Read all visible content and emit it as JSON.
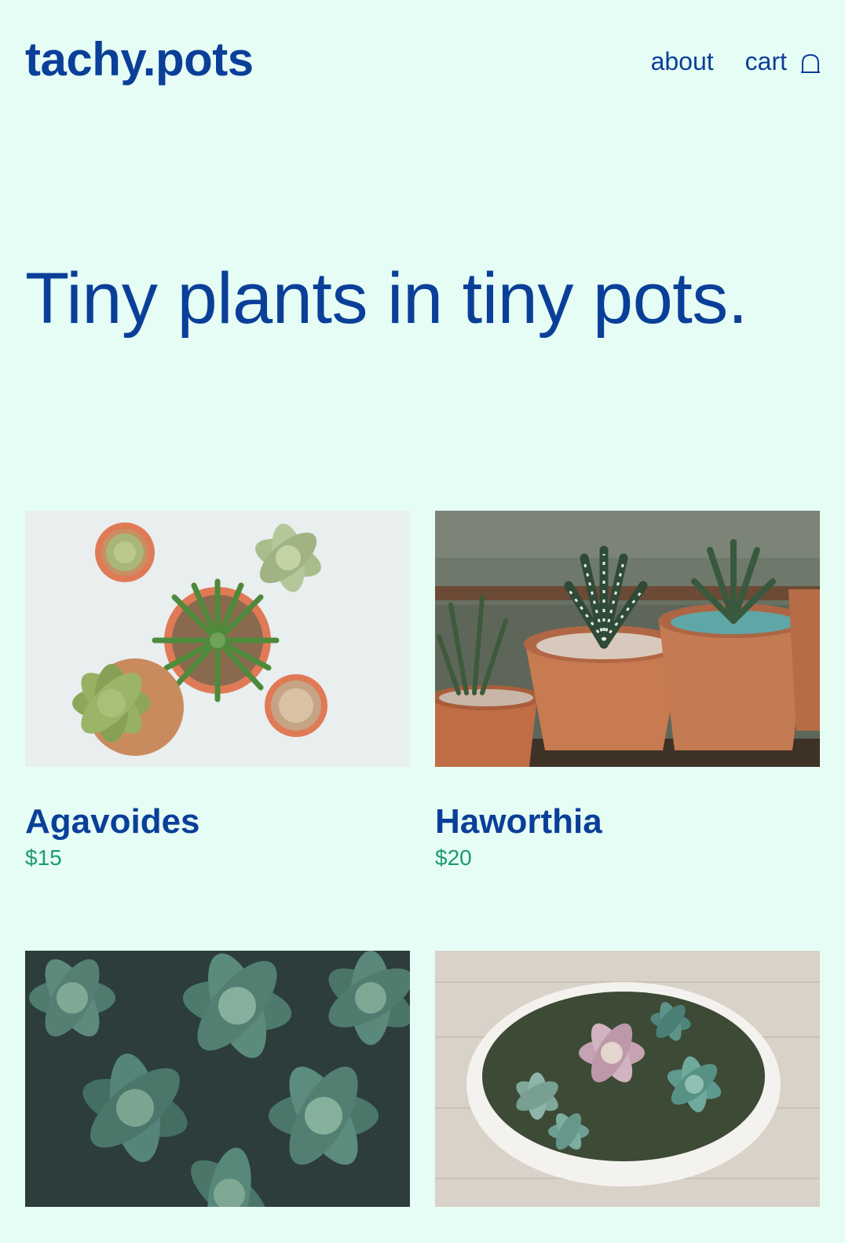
{
  "header": {
    "logo": "tachy.pots",
    "nav": {
      "about": "about",
      "cart": "cart",
      "cart_icon": "shopping-bag-icon"
    }
  },
  "hero": {
    "headline": "Tiny plants in tiny pots."
  },
  "products": [
    {
      "name": "Agavoides",
      "price": "$15"
    },
    {
      "name": "Haworthia",
      "price": "$20"
    },
    {
      "name": "",
      "price": ""
    },
    {
      "name": "",
      "price": ""
    }
  ],
  "colors": {
    "background": "#e6fdf5",
    "brand": "#0a3f99",
    "price": "#1e9b6b"
  }
}
